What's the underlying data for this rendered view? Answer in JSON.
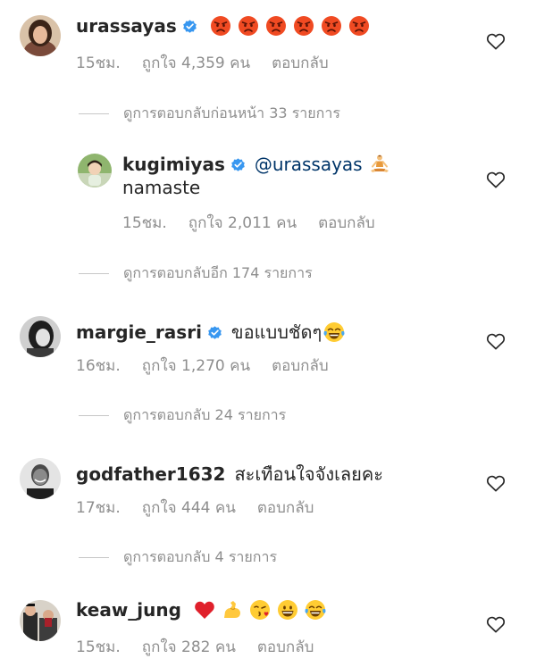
{
  "comments": [
    {
      "username": "urassayas",
      "verified": true,
      "text": "",
      "emojis": [
        "pouting-face",
        "pouting-face",
        "pouting-face",
        "pouting-face",
        "pouting-face",
        "pouting-face"
      ],
      "time": "15ชม.",
      "likes": "ถูกใจ 4,359 คน",
      "reply": "ตอบกลับ"
    },
    {
      "username": "kugimiyas",
      "verified": true,
      "mention": "@urassayas",
      "text": "namaste",
      "emojis": [
        "person-in-lotus-position"
      ],
      "time": "15ชม.",
      "likes": "ถูกใจ 2,011 คน",
      "reply": "ตอบกลับ"
    },
    {
      "username": "margie_rasri",
      "verified": true,
      "text": "ขอแบบชัดๆ",
      "emojis": [
        "tears-of-joy"
      ],
      "time": "16ชม.",
      "likes": "ถูกใจ 1,270 คน",
      "reply": "ตอบกลับ"
    },
    {
      "username": "godfather1632",
      "verified": false,
      "text": "สะเทือนใจจังเลยคะ",
      "emojis": [],
      "time": "17ชม.",
      "likes": "ถูกใจ 444 คน",
      "reply": "ตอบกลับ"
    },
    {
      "username": "keaw_jung",
      "verified": false,
      "text": "",
      "emojis": [
        "red-heart",
        "flexed-biceps",
        "face-blowing-kiss",
        "grinning-face",
        "tears-of-joy"
      ],
      "time": "15ชม.",
      "likes": "ถูกใจ 282 คน",
      "reply": "ตอบกลับ"
    }
  ],
  "view_replies": [
    "ดูการตอบกลับก่อนหน้า 33 รายการ",
    "ดูการตอบกลับอีก 174 รายการ",
    "ดูการตอบกลับ 24 รายการ",
    "ดูการตอบกลับ 4 รายการ"
  ],
  "colors": {
    "verified_blue": "#3897f0",
    "muted_text": "#8e8e8e",
    "username_text": "#262626",
    "mention_text": "#003569"
  }
}
